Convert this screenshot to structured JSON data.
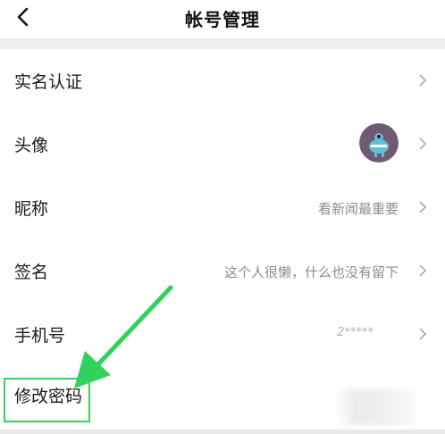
{
  "header": {
    "title": "帐号管理",
    "back_icon": "chevron-left-icon"
  },
  "rows": [
    {
      "label": "实名认证",
      "value": ""
    },
    {
      "label": "头像",
      "value": "",
      "avatar_icon": "monster-avatar"
    },
    {
      "label": "昵称",
      "value": "看新闻最重要"
    },
    {
      "label": "签名",
      "value": "这个人很懒，什么也没有留下"
    },
    {
      "label": "手机号",
      "value": "2*****"
    },
    {
      "label": "修改密码",
      "value": ""
    }
  ],
  "annotation": {
    "arrow_color": "#2fd35a",
    "box_color": "#2fd35a"
  },
  "colors": {
    "separator_band": "#efefef",
    "value_text": "#8d8d8d",
    "avatar_bg": "#6e5a73",
    "avatar_figure": "#5fc0d0"
  }
}
